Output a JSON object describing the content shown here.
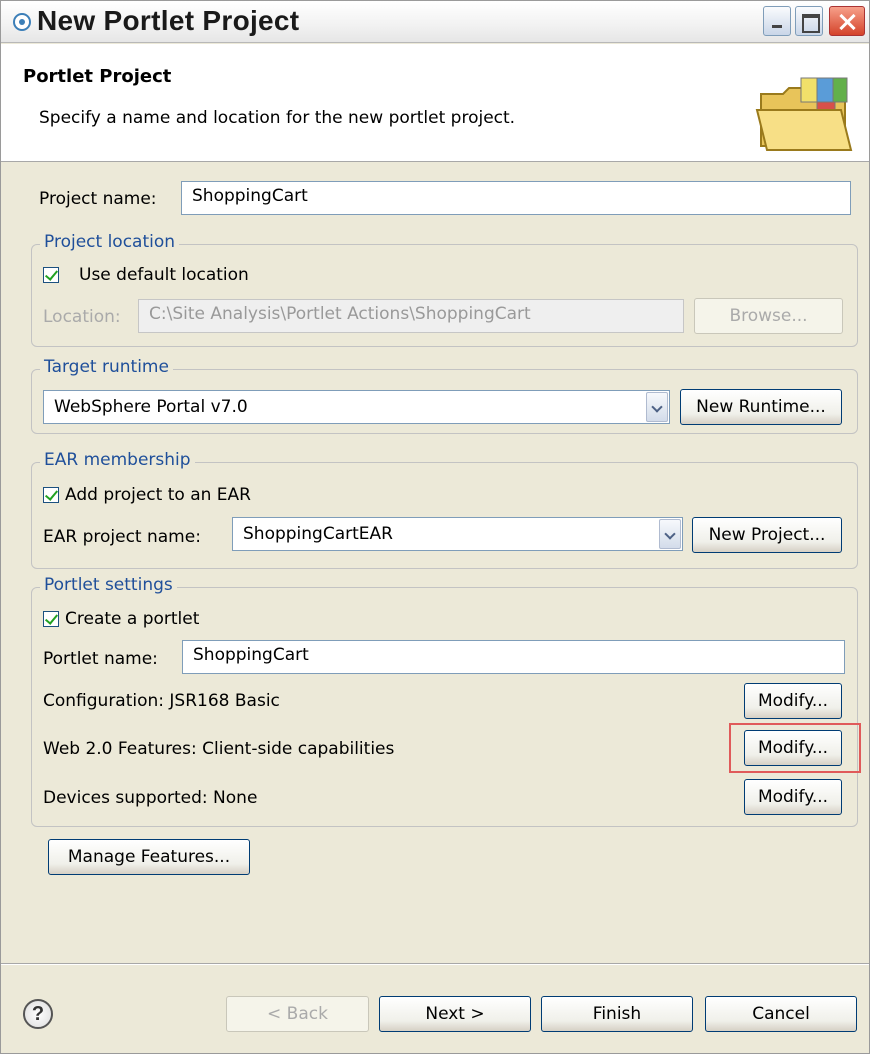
{
  "window": {
    "title": "New Portlet Project"
  },
  "banner": {
    "title": "Portlet Project",
    "description": "Specify a name and location for the new portlet project."
  },
  "project": {
    "name_label": "Project name:",
    "name_value": "ShoppingCart"
  },
  "location": {
    "legend": "Project location",
    "use_default_label": "Use default location",
    "use_default_checked": true,
    "location_label": "Location:",
    "location_value": "C:\\Site Analysis\\Portlet Actions\\ShoppingCart",
    "browse_label": "Browse..."
  },
  "runtime": {
    "legend": "Target runtime",
    "selected": "WebSphere Portal v7.0",
    "new_runtime_label": "New Runtime..."
  },
  "ear": {
    "legend": "EAR membership",
    "add_label": "Add project to an EAR",
    "add_checked": true,
    "project_name_label": "EAR project name:",
    "project_name_value": "ShoppingCartEAR",
    "new_project_label": "New Project..."
  },
  "portlet": {
    "legend": "Portlet settings",
    "create_label": "Create a portlet",
    "create_checked": true,
    "name_label": "Portlet name:",
    "name_value": "ShoppingCart",
    "configuration_label": "Configuration: JSR168 Basic",
    "web20_label": "Web 2.0 Features: Client-side capabilities",
    "devices_label": "Devices supported: None",
    "modify_label": "Modify..."
  },
  "manage_features_label": "Manage Features...",
  "footer": {
    "help_glyph": "?",
    "back_label": "< Back",
    "next_label": "Next >",
    "finish_label": "Finish",
    "cancel_label": "Cancel"
  },
  "colors": {
    "group_legend": "#1f4f9a",
    "highlight": "#e05a5a",
    "dialog_bg": "#ece9d8"
  }
}
